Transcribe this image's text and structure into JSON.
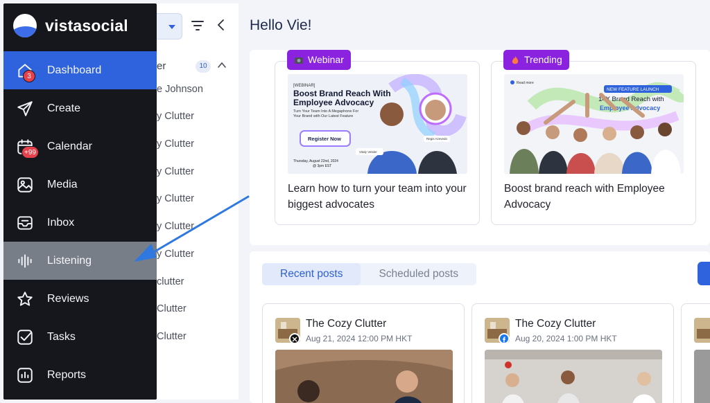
{
  "brand": {
    "name": "vistasocial"
  },
  "nav": [
    {
      "label": "Dashboard",
      "icon": "home-icon",
      "badge": "3",
      "state": "active"
    },
    {
      "label": "Create",
      "icon": "send-icon",
      "badge": "",
      "state": ""
    },
    {
      "label": "Calendar",
      "icon": "calendar-icon",
      "badge": "+99",
      "state": ""
    },
    {
      "label": "Media",
      "icon": "image-icon",
      "badge": "",
      "state": ""
    },
    {
      "label": "Inbox",
      "icon": "inbox-icon",
      "badge": "",
      "state": ""
    },
    {
      "label": "Listening",
      "icon": "sound-wave-icon",
      "badge": "",
      "state": "hover"
    },
    {
      "label": "Reviews",
      "icon": "star-icon",
      "badge": "",
      "state": ""
    },
    {
      "label": "Tasks",
      "icon": "checkbox-icon",
      "badge": "",
      "state": ""
    },
    {
      "label": "Reports",
      "icon": "bar-chart-icon",
      "badge": "",
      "state": ""
    }
  ],
  "midcol": {
    "group_label": "er",
    "group_count": "10",
    "items": [
      "e Johnson",
      "y Clutter",
      "y Clutter",
      "y Clutter",
      "y Clutter",
      "y Clutter",
      "y Clutter",
      "clutter",
      "Clutter",
      "Clutter"
    ]
  },
  "main": {
    "greeting": "Hello Vie!",
    "promos": [
      {
        "tag": "Webinar",
        "tag_icon": "webinar-icon",
        "title": "Learn how to turn your team into your biggest advocates",
        "image": {
          "kicker": "[WEBINAR]",
          "headline": "Boost Brand Reach With Employee Advocacy",
          "sub": "Turn Your Team Into A Megaphone For Your Brand with Our Latest Feature",
          "button": "Register Now",
          "date": "Thursday, August 22nd, 2024 @ 3pm EST",
          "speaker1": "Vitaly Vetsler",
          "speaker2": "Regis Azevedo"
        }
      },
      {
        "tag": "Trending",
        "tag_icon": "fire-icon",
        "title": "Boost brand reach with Employee Advocacy",
        "image": {
          "corner": "Read more",
          "kicker": "NEW FEATURE LAUNCH",
          "line1": "14X Brand Reach with",
          "line2": "Employee Advocacy"
        }
      }
    ],
    "tabs": [
      {
        "label": "Recent posts",
        "active": true
      },
      {
        "label": "Scheduled posts",
        "active": false
      }
    ],
    "posts": [
      {
        "name": "The Cozy Clutter",
        "date": "Aug 21, 2024 12:00 PM HKT",
        "network": "x-icon",
        "network_color": "#111111"
      },
      {
        "name": "The Cozy Clutter",
        "date": "Aug 20, 2024 1:00 PM HKT",
        "network": "facebook-icon",
        "network_color": "#1877f2"
      }
    ]
  },
  "colors": {
    "accent": "#2f63dd",
    "tag": "#8a22e0",
    "sidebar": "#16171d",
    "badge": "#e5414c",
    "arrow": "#2f78e0"
  }
}
